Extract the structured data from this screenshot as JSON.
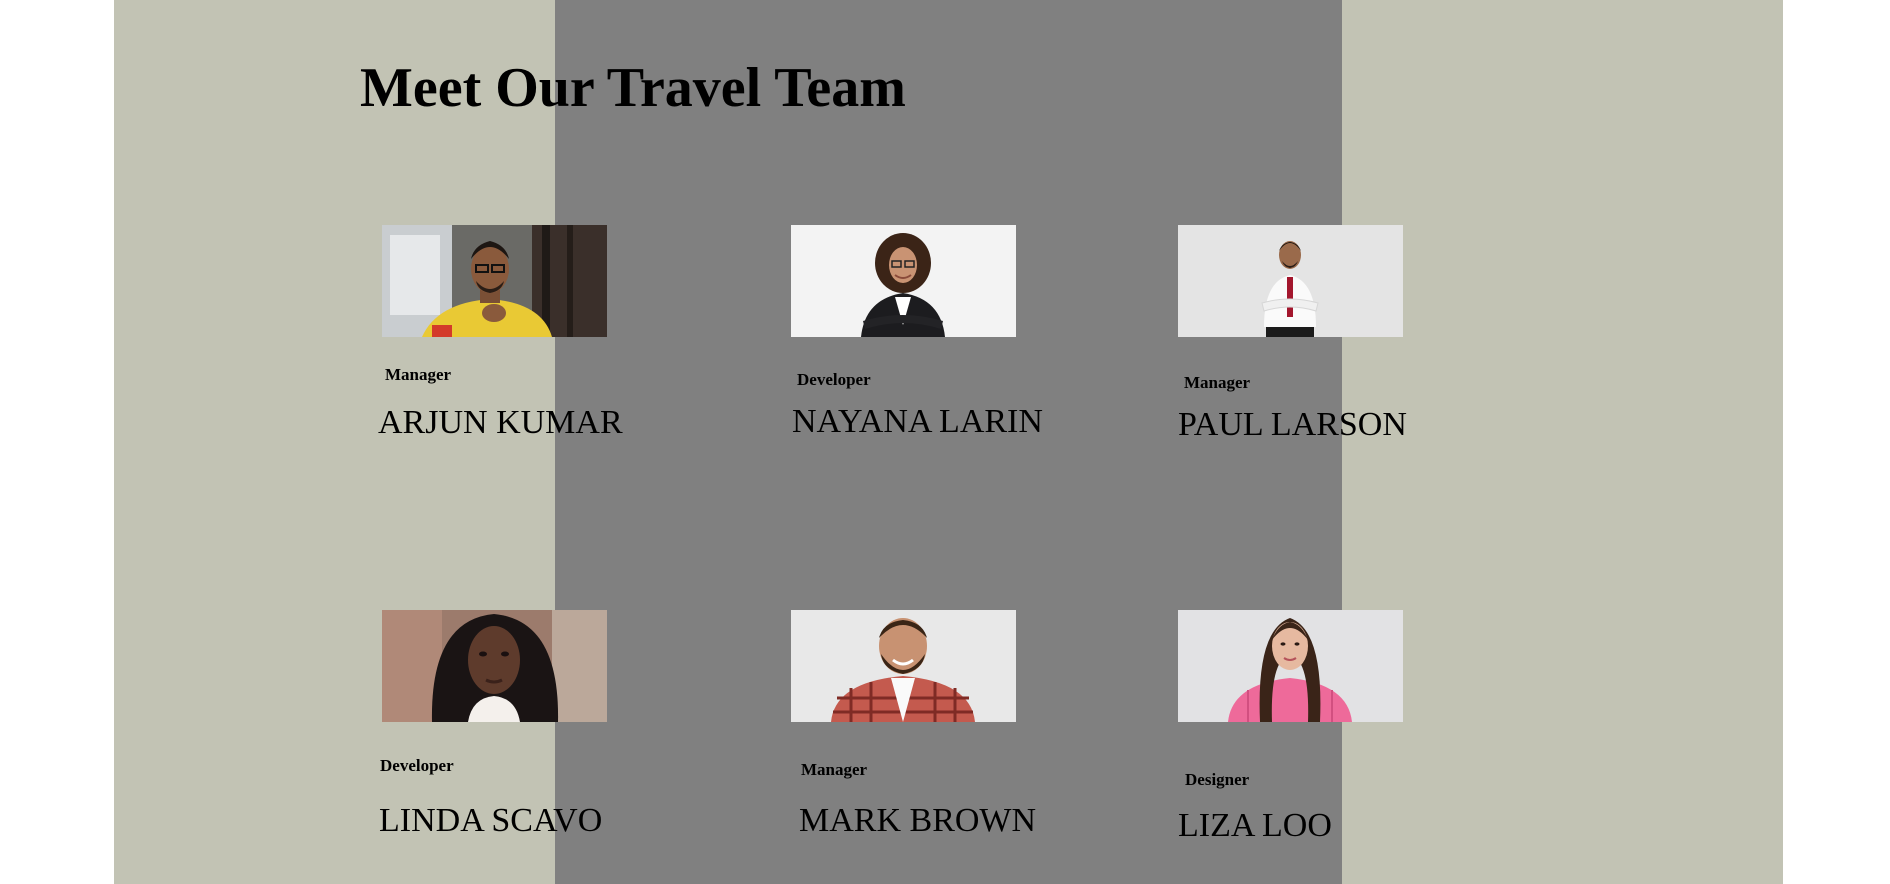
{
  "page": {
    "title": "Meet Our Travel Team"
  },
  "colors": {
    "side_background": "#c2c3b4",
    "center_background": "#808080",
    "text": "#000000"
  },
  "team": [
    {
      "role": "Manager",
      "name": "ARJUN KUMAR",
      "photo": "portrait-man-yellow-shirt-glasses"
    },
    {
      "role": "Developer",
      "name": "NAYANA LARIN",
      "photo": "portrait-woman-black-blazer"
    },
    {
      "role": "Manager",
      "name": "PAUL LARSON",
      "photo": "portrait-man-white-shirt-red-tie"
    },
    {
      "role": "Developer",
      "name": "LINDA SCAVO",
      "photo": "portrait-woman-curly-hair"
    },
    {
      "role": "Manager",
      "name": "MARK BROWN",
      "photo": "portrait-man-plaid-shirt"
    },
    {
      "role": "Designer",
      "name": "LIZA LOO",
      "photo": "portrait-woman-pink-sweater"
    }
  ]
}
